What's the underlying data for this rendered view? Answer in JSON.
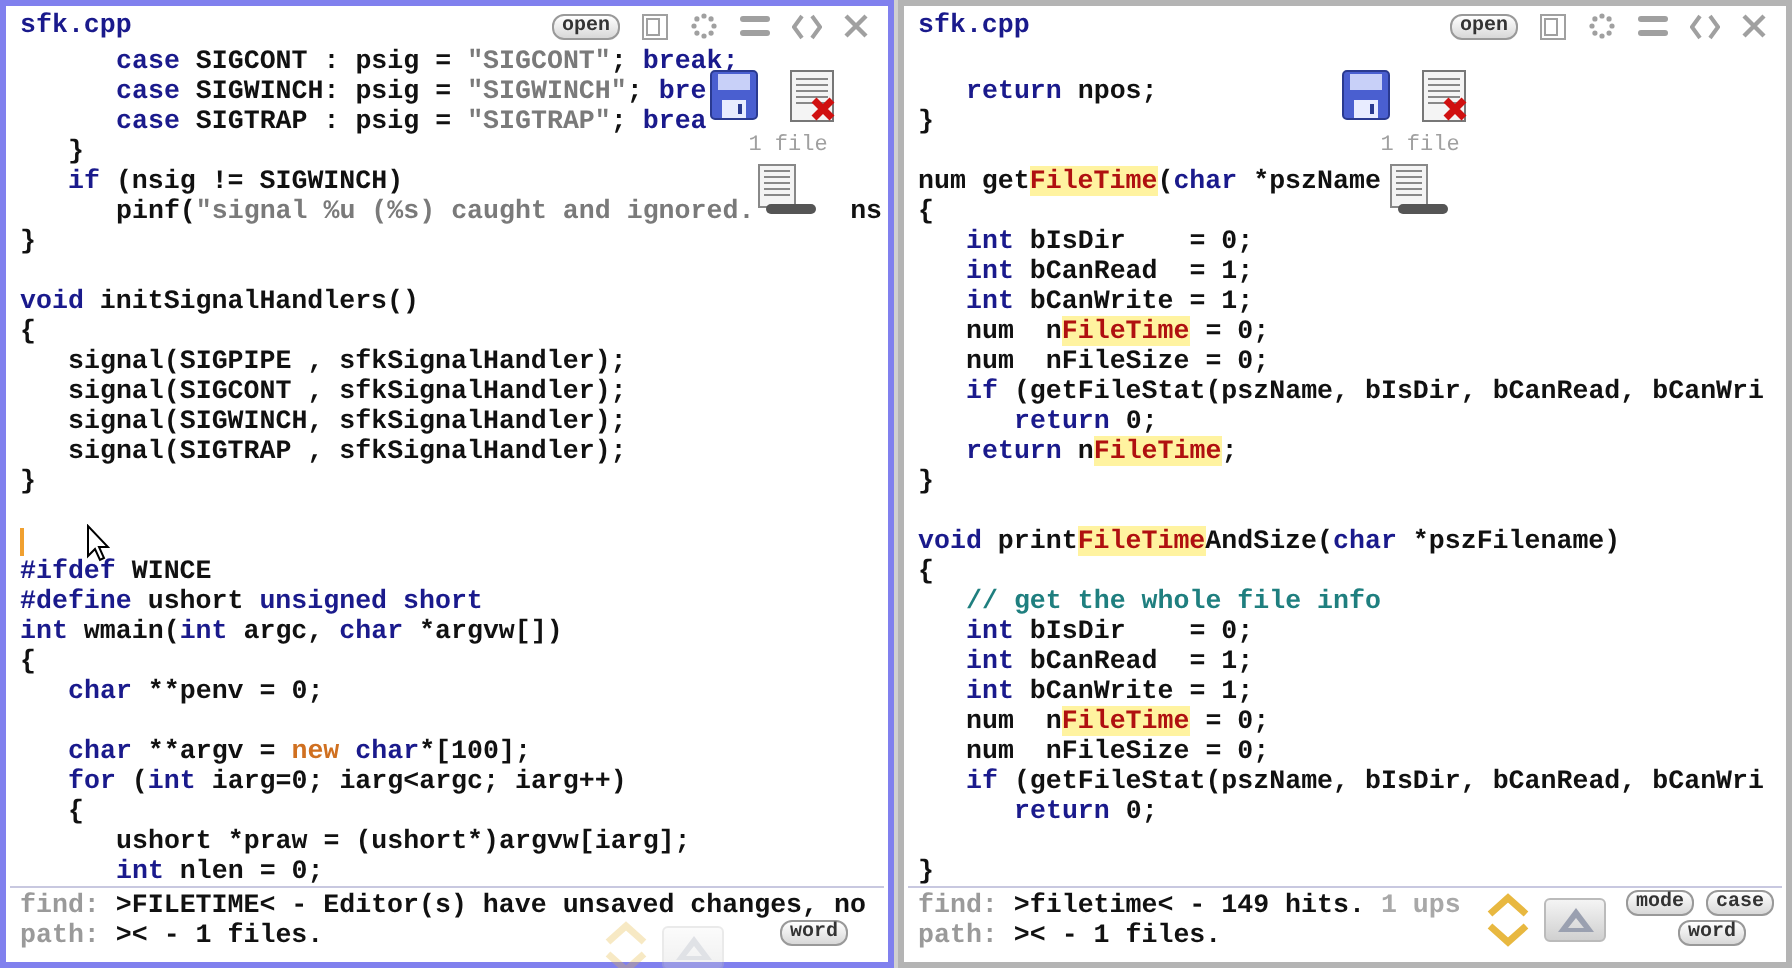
{
  "panes": [
    {
      "active": true,
      "title": "sfk.cpp",
      "open_button": "open",
      "file_count": "1 file",
      "lines": [
        {
          "kind": "i2",
          "tokens": [
            {
              "kind": "k",
              "text": "case"
            },
            {
              "kind": "p",
              "text": " SIGCONT : psig = "
            },
            {
              "kind": "s",
              "text": "\"SIGCONT\""
            },
            {
              "kind": "p",
              "text": "; "
            },
            {
              "kind": "k",
              "text": "break;"
            }
          ]
        },
        {
          "kind": "i2",
          "tokens": [
            {
              "kind": "k",
              "text": "case"
            },
            {
              "kind": "p",
              "text": " SIGWINCH: psig = "
            },
            {
              "kind": "s",
              "text": "\"SIGWINCH\""
            },
            {
              "kind": "p",
              "text": "; "
            },
            {
              "kind": "k",
              "text": "bre"
            }
          ]
        },
        {
          "kind": "i2",
          "tokens": [
            {
              "kind": "k",
              "text": "case"
            },
            {
              "kind": "p",
              "text": " SIGTRAP : psig = "
            },
            {
              "kind": "s",
              "text": "\"SIGTRAP\""
            },
            {
              "kind": "p",
              "text": "; "
            },
            {
              "kind": "k",
              "text": "brea"
            }
          ]
        },
        {
          "kind": "i1",
          "tokens": [
            {
              "kind": "p",
              "text": "}"
            }
          ]
        },
        {
          "kind": "i1",
          "tokens": [
            {
              "kind": "k",
              "text": "if"
            },
            {
              "kind": "p",
              "text": " (nsig != SIGWINCH)"
            }
          ]
        },
        {
          "kind": "i2",
          "tokens": [
            {
              "kind": "p",
              "text": "pinf("
            },
            {
              "kind": "s",
              "text": "\"signal %u (%s) caught and ignored."
            },
            {
              "kind": "p",
              "text": "      ns"
            }
          ]
        },
        {
          "kind": "i0",
          "tokens": [
            {
              "kind": "p",
              "text": "}"
            }
          ]
        },
        {
          "kind": "blank"
        },
        {
          "kind": "i0",
          "tokens": [
            {
              "kind": "k",
              "text": "void"
            },
            {
              "kind": "p",
              "text": " initSignalHandlers()"
            }
          ]
        },
        {
          "kind": "i0",
          "tokens": [
            {
              "kind": "p",
              "text": "{"
            }
          ]
        },
        {
          "kind": "i1",
          "tokens": [
            {
              "kind": "p",
              "text": "signal(SIGPIPE , sfkSignalHandler);"
            }
          ]
        },
        {
          "kind": "i1",
          "tokens": [
            {
              "kind": "p",
              "text": "signal(SIGCONT , sfkSignalHandler);"
            }
          ]
        },
        {
          "kind": "i1",
          "tokens": [
            {
              "kind": "p",
              "text": "signal(SIGWINCH, sfkSignalHandler);"
            }
          ]
        },
        {
          "kind": "i1",
          "tokens": [
            {
              "kind": "p",
              "text": "signal(SIGTRAP , sfkSignalHandler);"
            }
          ]
        },
        {
          "kind": "i0",
          "tokens": [
            {
              "kind": "p",
              "text": "}"
            }
          ]
        },
        {
          "kind": "blank"
        },
        {
          "kind": "caret"
        },
        {
          "kind": "i0",
          "tokens": [
            {
              "kind": "k",
              "text": "#ifdef"
            },
            {
              "kind": "p",
              "text": " WINCE"
            }
          ]
        },
        {
          "kind": "i0",
          "tokens": [
            {
              "kind": "k",
              "text": "#define"
            },
            {
              "kind": "p",
              "text": " ushort "
            },
            {
              "kind": "k",
              "text": "unsigned short"
            }
          ]
        },
        {
          "kind": "i0",
          "tokens": [
            {
              "kind": "k",
              "text": "int"
            },
            {
              "kind": "p",
              "text": " wmain("
            },
            {
              "kind": "k",
              "text": "int"
            },
            {
              "kind": "p",
              "text": " argc, "
            },
            {
              "kind": "k",
              "text": "char"
            },
            {
              "kind": "p",
              "text": " *argvw[])"
            }
          ]
        },
        {
          "kind": "i0",
          "tokens": [
            {
              "kind": "p",
              "text": "{"
            }
          ]
        },
        {
          "kind": "i1",
          "tokens": [
            {
              "kind": "k",
              "text": "char"
            },
            {
              "kind": "p",
              "text": " **penv = 0;"
            }
          ]
        },
        {
          "kind": "blank"
        },
        {
          "kind": "i1",
          "tokens": [
            {
              "kind": "k",
              "text": "char"
            },
            {
              "kind": "p",
              "text": " **argv = "
            },
            {
              "kind": "n",
              "text": "new"
            },
            {
              "kind": "k",
              "text": " char"
            },
            {
              "kind": "p",
              "text": "*[100];"
            }
          ]
        },
        {
          "kind": "i1",
          "tokens": [
            {
              "kind": "k",
              "text": "for"
            },
            {
              "kind": "p",
              "text": " ("
            },
            {
              "kind": "k",
              "text": "int"
            },
            {
              "kind": "p",
              "text": " iarg=0; iarg<argc; iarg++)"
            }
          ]
        },
        {
          "kind": "i1",
          "tokens": [
            {
              "kind": "p",
              "text": "{"
            }
          ]
        },
        {
          "kind": "i2",
          "tokens": [
            {
              "kind": "p",
              "text": "ushort *praw = (ushort*)argvw[iarg];"
            }
          ]
        },
        {
          "kind": "i2",
          "tokens": [
            {
              "kind": "k",
              "text": "int"
            },
            {
              "kind": "p",
              "text": " nlen = 0;"
            }
          ]
        }
      ],
      "find": {
        "label": "find:",
        "status": ">FILETIME< - Editor(s) have unsaved changes, no"
      },
      "path": {
        "label": "path:",
        "value": ">< - 1 files."
      },
      "nav_enabled": false,
      "buttons": [
        {
          "label": "word"
        }
      ]
    },
    {
      "active": false,
      "title": "sfk.cpp",
      "open_button": "open",
      "file_count": "1 file",
      "lines": [
        {
          "kind": "blank"
        },
        {
          "kind": "i1",
          "tokens": [
            {
              "kind": "k",
              "text": "return"
            },
            {
              "kind": "p",
              "text": " npos;"
            }
          ]
        },
        {
          "kind": "i0",
          "tokens": [
            {
              "kind": "p",
              "text": "}"
            }
          ]
        },
        {
          "kind": "blank"
        },
        {
          "kind": "i0",
          "tokens": [
            {
              "kind": "p",
              "text": "num get"
            },
            {
              "kind": "h",
              "text": "FileTime"
            },
            {
              "kind": "p",
              "text": "("
            },
            {
              "kind": "k",
              "text": "char"
            },
            {
              "kind": "p",
              "text": " *pszName"
            }
          ]
        },
        {
          "kind": "i0",
          "tokens": [
            {
              "kind": "p",
              "text": "{"
            }
          ]
        },
        {
          "kind": "i1",
          "tokens": [
            {
              "kind": "k",
              "text": "int"
            },
            {
              "kind": "p",
              "text": " bIsDir    = 0;"
            }
          ]
        },
        {
          "kind": "i1",
          "tokens": [
            {
              "kind": "k",
              "text": "int"
            },
            {
              "kind": "p",
              "text": " bCanRead  = 1;"
            }
          ]
        },
        {
          "kind": "i1",
          "tokens": [
            {
              "kind": "k",
              "text": "int"
            },
            {
              "kind": "p",
              "text": " bCanWrite = 1;"
            }
          ]
        },
        {
          "kind": "i1",
          "tokens": [
            {
              "kind": "p",
              "text": "num  n"
            },
            {
              "kind": "h",
              "text": "FileTime"
            },
            {
              "kind": "p",
              "text": " = 0;"
            }
          ]
        },
        {
          "kind": "i1",
          "tokens": [
            {
              "kind": "p",
              "text": "num  nFileSize = 0;"
            }
          ]
        },
        {
          "kind": "i1",
          "tokens": [
            {
              "kind": "k",
              "text": "if"
            },
            {
              "kind": "p",
              "text": " (getFileStat(pszName, bIsDir, bCanRead, bCanWri"
            }
          ]
        },
        {
          "kind": "i2",
          "tokens": [
            {
              "kind": "k",
              "text": "return"
            },
            {
              "kind": "p",
              "text": " 0;"
            }
          ]
        },
        {
          "kind": "i1",
          "tokens": [
            {
              "kind": "k",
              "text": "return"
            },
            {
              "kind": "p",
              "text": " n"
            },
            {
              "kind": "h",
              "text": "FileTime"
            },
            {
              "kind": "p",
              "text": ";"
            }
          ]
        },
        {
          "kind": "i0",
          "tokens": [
            {
              "kind": "p",
              "text": "}"
            }
          ]
        },
        {
          "kind": "blank"
        },
        {
          "kind": "i0",
          "tokens": [
            {
              "kind": "k",
              "text": "void"
            },
            {
              "kind": "p",
              "text": " print"
            },
            {
              "kind": "h",
              "text": "FileTime"
            },
            {
              "kind": "p",
              "text": "AndSize("
            },
            {
              "kind": "k",
              "text": "char"
            },
            {
              "kind": "p",
              "text": " *pszFilename)"
            }
          ]
        },
        {
          "kind": "i0",
          "tokens": [
            {
              "kind": "p",
              "text": "{"
            }
          ]
        },
        {
          "kind": "i1",
          "tokens": [
            {
              "kind": "c",
              "text": "// get the whole file info"
            }
          ]
        },
        {
          "kind": "i1",
          "tokens": [
            {
              "kind": "k",
              "text": "int"
            },
            {
              "kind": "p",
              "text": " bIsDir    = 0;"
            }
          ]
        },
        {
          "kind": "i1",
          "tokens": [
            {
              "kind": "k",
              "text": "int"
            },
            {
              "kind": "p",
              "text": " bCanRead  = 1;"
            }
          ]
        },
        {
          "kind": "i1",
          "tokens": [
            {
              "kind": "k",
              "text": "int"
            },
            {
              "kind": "p",
              "text": " bCanWrite = 1;"
            }
          ]
        },
        {
          "kind": "i1",
          "tokens": [
            {
              "kind": "p",
              "text": "num  n"
            },
            {
              "kind": "h",
              "text": "FileTime"
            },
            {
              "kind": "p",
              "text": " = 0;"
            }
          ]
        },
        {
          "kind": "i1",
          "tokens": [
            {
              "kind": "p",
              "text": "num  nFileSize = 0;"
            }
          ]
        },
        {
          "kind": "i1",
          "tokens": [
            {
              "kind": "k",
              "text": "if"
            },
            {
              "kind": "p",
              "text": " (getFileStat(pszName, bIsDir, bCanRead, bCanWri"
            }
          ]
        },
        {
          "kind": "i2",
          "tokens": [
            {
              "kind": "k",
              "text": "return"
            },
            {
              "kind": "p",
              "text": " 0;"
            }
          ]
        },
        {
          "kind": "blank"
        },
        {
          "kind": "i0",
          "tokens": [
            {
              "kind": "p",
              "text": "}"
            }
          ]
        }
      ],
      "find": {
        "label": "find:",
        "status": ">filetime< - 149 hits.",
        "note": "1 ups"
      },
      "path": {
        "label": "path:",
        "value": ">< - 1 files."
      },
      "nav_enabled": true,
      "buttons": [
        {
          "label": "mode"
        },
        {
          "label": "case"
        },
        {
          "label": "word"
        }
      ]
    }
  ]
}
